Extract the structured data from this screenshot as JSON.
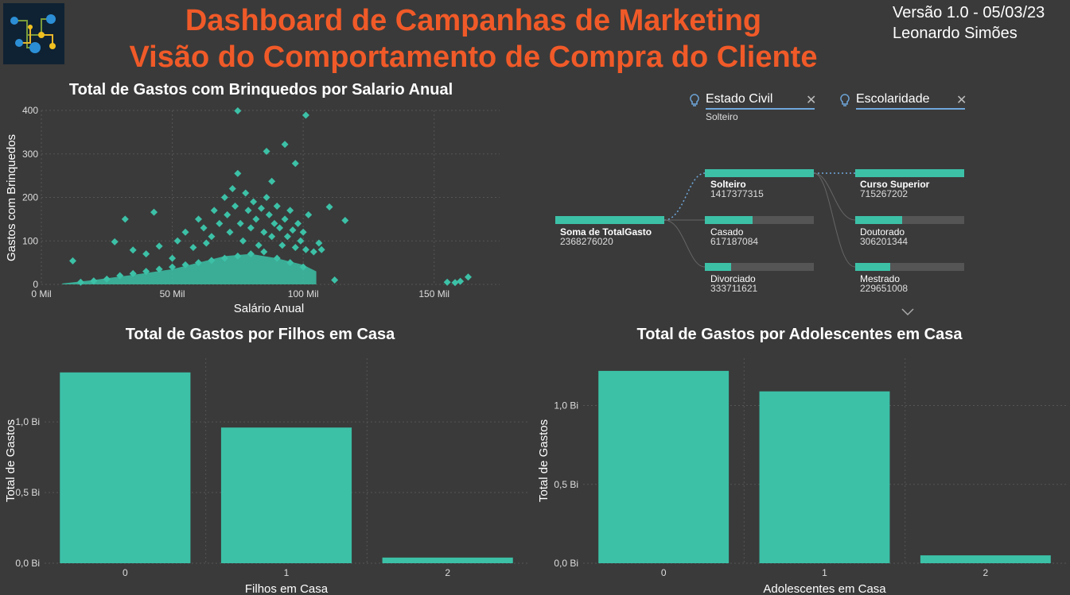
{
  "header": {
    "title_line1": "Dashboard de Campanhas de Marketing",
    "title_line2": "Visão do Comportamento de Compra do Cliente",
    "version": "Versão 1.0 - 05/03/23",
    "author": "Leonardo Simões"
  },
  "colors": {
    "accent": "#3cc1a7",
    "title": "#f05a28",
    "background": "#3a3a3a",
    "slicer_line": "#6fa8dc"
  },
  "slicers": [
    {
      "label": "Estado Civil",
      "value": "Solteiro",
      "icon": "lightbulb-icon"
    },
    {
      "label": "Escolaridade",
      "value": "",
      "icon": "lightbulb-icon"
    }
  ],
  "decomposition": {
    "root": {
      "label": "Soma de TotalGasto",
      "value": "2368276020"
    },
    "level1": [
      {
        "label": "Solteiro",
        "value": "1417377315",
        "selected": true,
        "share": 1.0
      },
      {
        "label": "Casado",
        "value": "617187084",
        "selected": false,
        "share": 0.44
      },
      {
        "label": "Divorciado",
        "value": "333711621",
        "selected": false,
        "share": 0.24
      }
    ],
    "level2": [
      {
        "label": "Curso Superior",
        "value": "715267202",
        "selected": true,
        "share": 1.0
      },
      {
        "label": "Doutorado",
        "value": "306201344",
        "selected": false,
        "share": 0.43
      },
      {
        "label": "Mestrado",
        "value": "229651008",
        "selected": false,
        "share": 0.32
      }
    ],
    "expand_icon": "chevron-down-icon"
  },
  "chart_data": [
    {
      "type": "scatter",
      "title": "Total de Gastos com Brinquedos por Salario Anual",
      "xlabel": "Salário Anual",
      "ylabel": "Gastos com Brinquedos",
      "xlim": [
        0,
        175000
      ],
      "ylim": [
        0,
        400
      ],
      "xticks": [
        {
          "v": 0,
          "label": "0 Mil"
        },
        {
          "v": 50000,
          "label": "50 Mil"
        },
        {
          "v": 100000,
          "label": "100 Mil"
        },
        {
          "v": 150000,
          "label": "150 Mil"
        }
      ],
      "yticks": [
        {
          "v": 0,
          "label": "0"
        },
        {
          "v": 100,
          "label": "100"
        },
        {
          "v": 200,
          "label": "200"
        },
        {
          "v": 300,
          "label": "300"
        },
        {
          "v": 400,
          "label": "400"
        }
      ],
      "grid": true,
      "marker": "diamond",
      "points": [
        [
          75000,
          399
        ],
        [
          101000,
          389
        ],
        [
          93000,
          322
        ],
        [
          86000,
          306
        ],
        [
          97000,
          278
        ],
        [
          75000,
          255
        ],
        [
          88000,
          237
        ],
        [
          110000,
          178
        ],
        [
          43000,
          166
        ],
        [
          32000,
          150
        ],
        [
          116000,
          147
        ],
        [
          12000,
          54
        ],
        [
          28000,
          98
        ],
        [
          35000,
          79
        ],
        [
          40000,
          70
        ],
        [
          45000,
          88
        ],
        [
          50000,
          60
        ],
        [
          52000,
          100
        ],
        [
          55000,
          120
        ],
        [
          58000,
          85
        ],
        [
          60000,
          150
        ],
        [
          62000,
          130
        ],
        [
          63000,
          95
        ],
        [
          65000,
          110
        ],
        [
          66000,
          170
        ],
        [
          68000,
          140
        ],
        [
          70000,
          200
        ],
        [
          71000,
          160
        ],
        [
          72000,
          120
        ],
        [
          73000,
          220
        ],
        [
          74000,
          180
        ],
        [
          76000,
          140
        ],
        [
          77000,
          100
        ],
        [
          78000,
          210
        ],
        [
          79000,
          170
        ],
        [
          80000,
          130
        ],
        [
          81000,
          190
        ],
        [
          82000,
          150
        ],
        [
          83000,
          90
        ],
        [
          84000,
          175
        ],
        [
          85000,
          120
        ],
        [
          86000,
          200
        ],
        [
          87000,
          160
        ],
        [
          88000,
          110
        ],
        [
          89000,
          140
        ],
        [
          90000,
          180
        ],
        [
          91000,
          130
        ],
        [
          92000,
          90
        ],
        [
          93000,
          150
        ],
        [
          94000,
          110
        ],
        [
          95000,
          170
        ],
        [
          96000,
          125
        ],
        [
          97000,
          85
        ],
        [
          98000,
          140
        ],
        [
          99000,
          100
        ],
        [
          100000,
          120
        ],
        [
          101000,
          80
        ],
        [
          102000,
          160
        ],
        [
          104000,
          75
        ],
        [
          106000,
          95
        ],
        [
          107000,
          80
        ],
        [
          112000,
          10
        ],
        [
          155000,
          5
        ],
        [
          160000,
          7
        ],
        [
          163000,
          17
        ],
        [
          158000,
          4
        ],
        [
          15000,
          5
        ],
        [
          20000,
          8
        ],
        [
          25000,
          12
        ],
        [
          30000,
          20
        ],
        [
          35000,
          25
        ],
        [
          40000,
          30
        ],
        [
          45000,
          35
        ],
        [
          50000,
          40
        ],
        [
          55000,
          45
        ],
        [
          60000,
          50
        ],
        [
          65000,
          55
        ],
        [
          70000,
          60
        ],
        [
          75000,
          65
        ],
        [
          80000,
          70
        ],
        [
          85000,
          75
        ],
        [
          90000,
          60
        ],
        [
          95000,
          50
        ],
        [
          100000,
          40
        ]
      ],
      "density_band": [
        [
          8000,
          2
        ],
        [
          20000,
          10
        ],
        [
          35000,
          22
        ],
        [
          50000,
          35
        ],
        [
          60000,
          50
        ],
        [
          70000,
          65
        ],
        [
          80000,
          70
        ],
        [
          90000,
          60
        ],
        [
          100000,
          45
        ],
        [
          105000,
          30
        ]
      ]
    },
    {
      "type": "bar",
      "title": "Total de Gastos por Filhos em Casa",
      "xlabel": "Filhos em Casa",
      "ylabel": "Total de Gastos",
      "categories": [
        "0",
        "1",
        "2"
      ],
      "values": [
        1.35,
        0.96,
        0.04
      ],
      "ylim": [
        0,
        1.45
      ],
      "yticks": [
        {
          "v": 0,
          "label": "0,0 Bi"
        },
        {
          "v": 0.5,
          "label": "0,5 Bi"
        },
        {
          "v": 1.0,
          "label": "1,0 Bi"
        }
      ],
      "grid": true
    },
    {
      "type": "bar",
      "title": "Total de Gastos por Adolescentes em Casa",
      "xlabel": "Adolescentes em Casa",
      "ylabel": "Total de Gastos",
      "categories": [
        "0",
        "1",
        "2"
      ],
      "values": [
        1.22,
        1.09,
        0.05
      ],
      "ylim": [
        0,
        1.3
      ],
      "yticks": [
        {
          "v": 0,
          "label": "0,0 Bi"
        },
        {
          "v": 0.5,
          "label": "0,5 Bi"
        },
        {
          "v": 1.0,
          "label": "1,0 Bi"
        }
      ],
      "grid": true
    }
  ]
}
